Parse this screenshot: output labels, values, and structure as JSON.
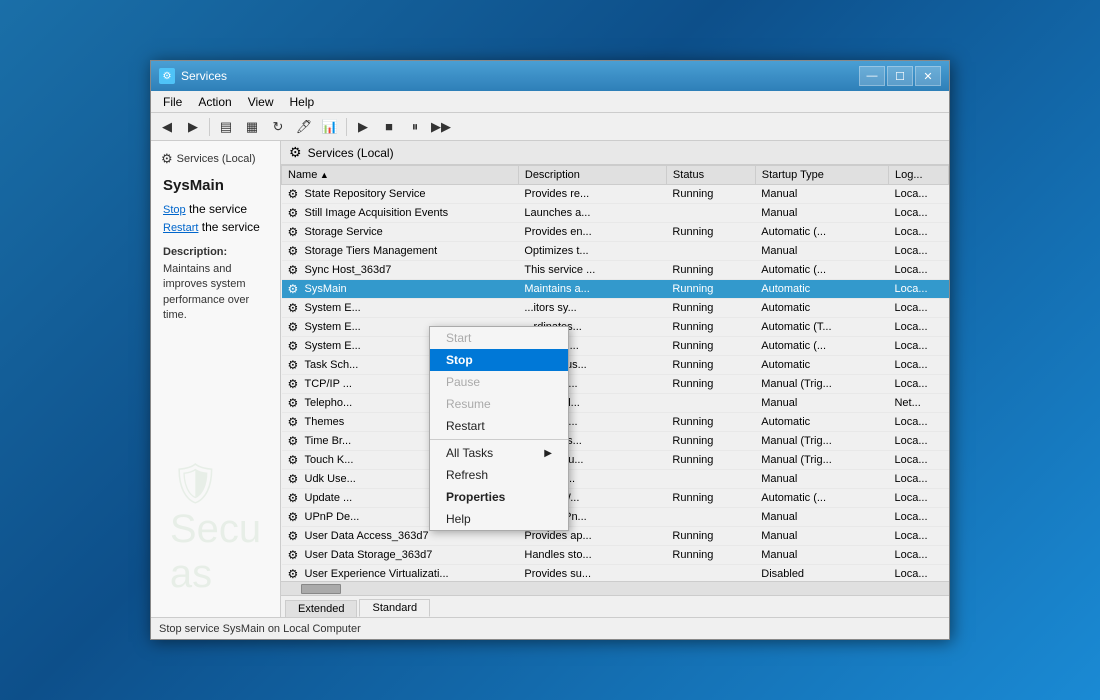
{
  "window": {
    "title": "Services",
    "minimize": "—",
    "maximize": "☐",
    "close": "✕"
  },
  "menu": {
    "items": [
      "File",
      "Action",
      "View",
      "Help"
    ]
  },
  "toolbar": {
    "buttons": [
      "←",
      "→",
      "📋",
      "📄",
      "🔄",
      "🖊",
      "📊",
      "▶",
      "■",
      "⏸",
      "▶▶"
    ]
  },
  "left_panel": {
    "title": "Services (Local)",
    "service_name": "SysMain",
    "stop_label": "Stop",
    "stop_text": " the service",
    "restart_label": "Restart",
    "restart_text": " the service",
    "desc_label": "Description:",
    "desc_text": "Maintains and improves system performance over time."
  },
  "services_header": {
    "title": "Services (Local)"
  },
  "table": {
    "columns": [
      "Name",
      "Description",
      "Status",
      "Startup Type",
      "Log..."
    ],
    "rows": [
      {
        "name": "State Repository Service",
        "desc": "Provides re...",
        "status": "Running",
        "startup": "Manual",
        "log": "Loca..."
      },
      {
        "name": "Still Image Acquisition Events",
        "desc": "Launches a...",
        "status": "",
        "startup": "Manual",
        "log": "Loca..."
      },
      {
        "name": "Storage Service",
        "desc": "Provides en...",
        "status": "Running",
        "startup": "Automatic (...",
        "log": "Loca..."
      },
      {
        "name": "Storage Tiers Management",
        "desc": "Optimizes t...",
        "status": "",
        "startup": "Manual",
        "log": "Loca..."
      },
      {
        "name": "Sync Host_363d7",
        "desc": "This service ...",
        "status": "Running",
        "startup": "Automatic (...",
        "log": "Loca..."
      },
      {
        "name": "SysMain",
        "desc": "Maintains a...",
        "status": "Running",
        "startup": "Automatic",
        "log": "Loca...",
        "selected": true
      },
      {
        "name": "System E...",
        "desc": "...itors sy...",
        "status": "Running",
        "startup": "Automatic",
        "log": "Loca..."
      },
      {
        "name": "System E...",
        "desc": "...rdinates...",
        "status": "Running",
        "startup": "Automatic (T...",
        "log": "Loca..."
      },
      {
        "name": "System E...",
        "desc": "...itors an...",
        "status": "Running",
        "startup": "Automatic (...",
        "log": "Loca..."
      },
      {
        "name": "Task Sch...",
        "desc": "...bles a us...",
        "status": "Running",
        "startup": "Automatic",
        "log": "Loca..."
      },
      {
        "name": "TCP/IP ...",
        "desc": "...ides su...",
        "status": "Running",
        "startup": "Manual (Trig...",
        "log": "Loca..."
      },
      {
        "name": "Telepho...",
        "desc": "...ides Tel...",
        "status": "",
        "startup": "Manual",
        "log": "Net..."
      },
      {
        "name": "Themes",
        "desc": "...ides us...",
        "status": "Running",
        "startup": "Automatic",
        "log": "Loca..."
      },
      {
        "name": "Time Br...",
        "desc": "...rdinates...",
        "status": "Running",
        "startup": "Manual (Trig...",
        "log": "Loca..."
      },
      {
        "name": "Touch K...",
        "desc": "...bles Tou...",
        "status": "Running",
        "startup": "Manual (Trig...",
        "log": "Loca..."
      },
      {
        "name": "Udk Use...",
        "desc": "...l comp...",
        "status": "",
        "startup": "Manual",
        "log": "Loca..."
      },
      {
        "name": "Update ...",
        "desc": "...ages W...",
        "status": "Running",
        "startup": "Automatic (...",
        "log": "Loca..."
      },
      {
        "name": "UPnP De...",
        "desc": "...ows UPn...",
        "status": "",
        "startup": "Manual",
        "log": "Loca..."
      },
      {
        "name": "User Data Access_363d7",
        "desc": "Provides ap...",
        "status": "Running",
        "startup": "Manual",
        "log": "Loca..."
      },
      {
        "name": "User Data Storage_363d7",
        "desc": "Handles sto...",
        "status": "Running",
        "startup": "Manual",
        "log": "Loca..."
      },
      {
        "name": "User Experience Virtualizati...",
        "desc": "Provides su...",
        "status": "",
        "startup": "Disabled",
        "log": "Loca..."
      }
    ]
  },
  "context_menu": {
    "items": [
      {
        "label": "Start",
        "disabled": true
      },
      {
        "label": "Stop",
        "disabled": false,
        "highlighted": true
      },
      {
        "label": "Pause",
        "disabled": true
      },
      {
        "label": "Resume",
        "disabled": true
      },
      {
        "label": "Restart",
        "disabled": false
      },
      {
        "label": "All Tasks",
        "disabled": false,
        "has_submenu": true
      },
      {
        "label": "Refresh",
        "disabled": false
      },
      {
        "label": "Properties",
        "disabled": false,
        "bold": true
      },
      {
        "label": "Help",
        "disabled": false
      }
    ]
  },
  "tabs": [
    {
      "label": "Extended",
      "active": false
    },
    {
      "label": "Standard",
      "active": true
    }
  ],
  "status_bar": {
    "text": "Stop service SysMain on Local Computer"
  }
}
